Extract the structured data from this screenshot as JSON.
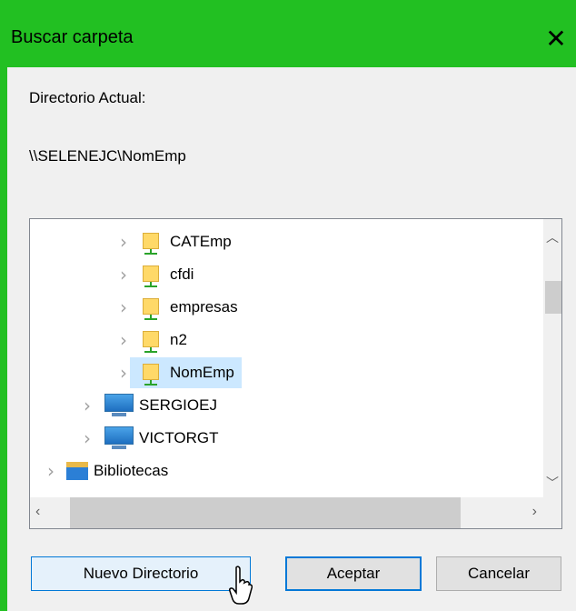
{
  "window": {
    "title": "Buscar carpeta"
  },
  "labels": {
    "current_directory": "Directorio Actual:",
    "current_path": "\\\\SELENEJC\\NomEmp"
  },
  "tree": {
    "items": [
      {
        "label": "CATEmp",
        "icon": "network-folder-icon"
      },
      {
        "label": "cfdi",
        "icon": "network-folder-icon"
      },
      {
        "label": "empresas",
        "icon": "network-folder-icon"
      },
      {
        "label": "n2",
        "icon": "network-folder-icon"
      },
      {
        "label": "NomEmp",
        "icon": "network-folder-icon",
        "selected": true
      },
      {
        "label": "SERGIOEJ",
        "icon": "computer-icon"
      },
      {
        "label": "VICTORGT",
        "icon": "computer-icon"
      },
      {
        "label": "Bibliotecas",
        "icon": "libraries-icon"
      }
    ]
  },
  "buttons": {
    "new_directory": "Nuevo Directorio",
    "accept": "Aceptar",
    "cancel": "Cancelar"
  },
  "colors": {
    "titlebar": "#22c022",
    "selection": "#cce8ff",
    "accent": "#0078d7"
  }
}
